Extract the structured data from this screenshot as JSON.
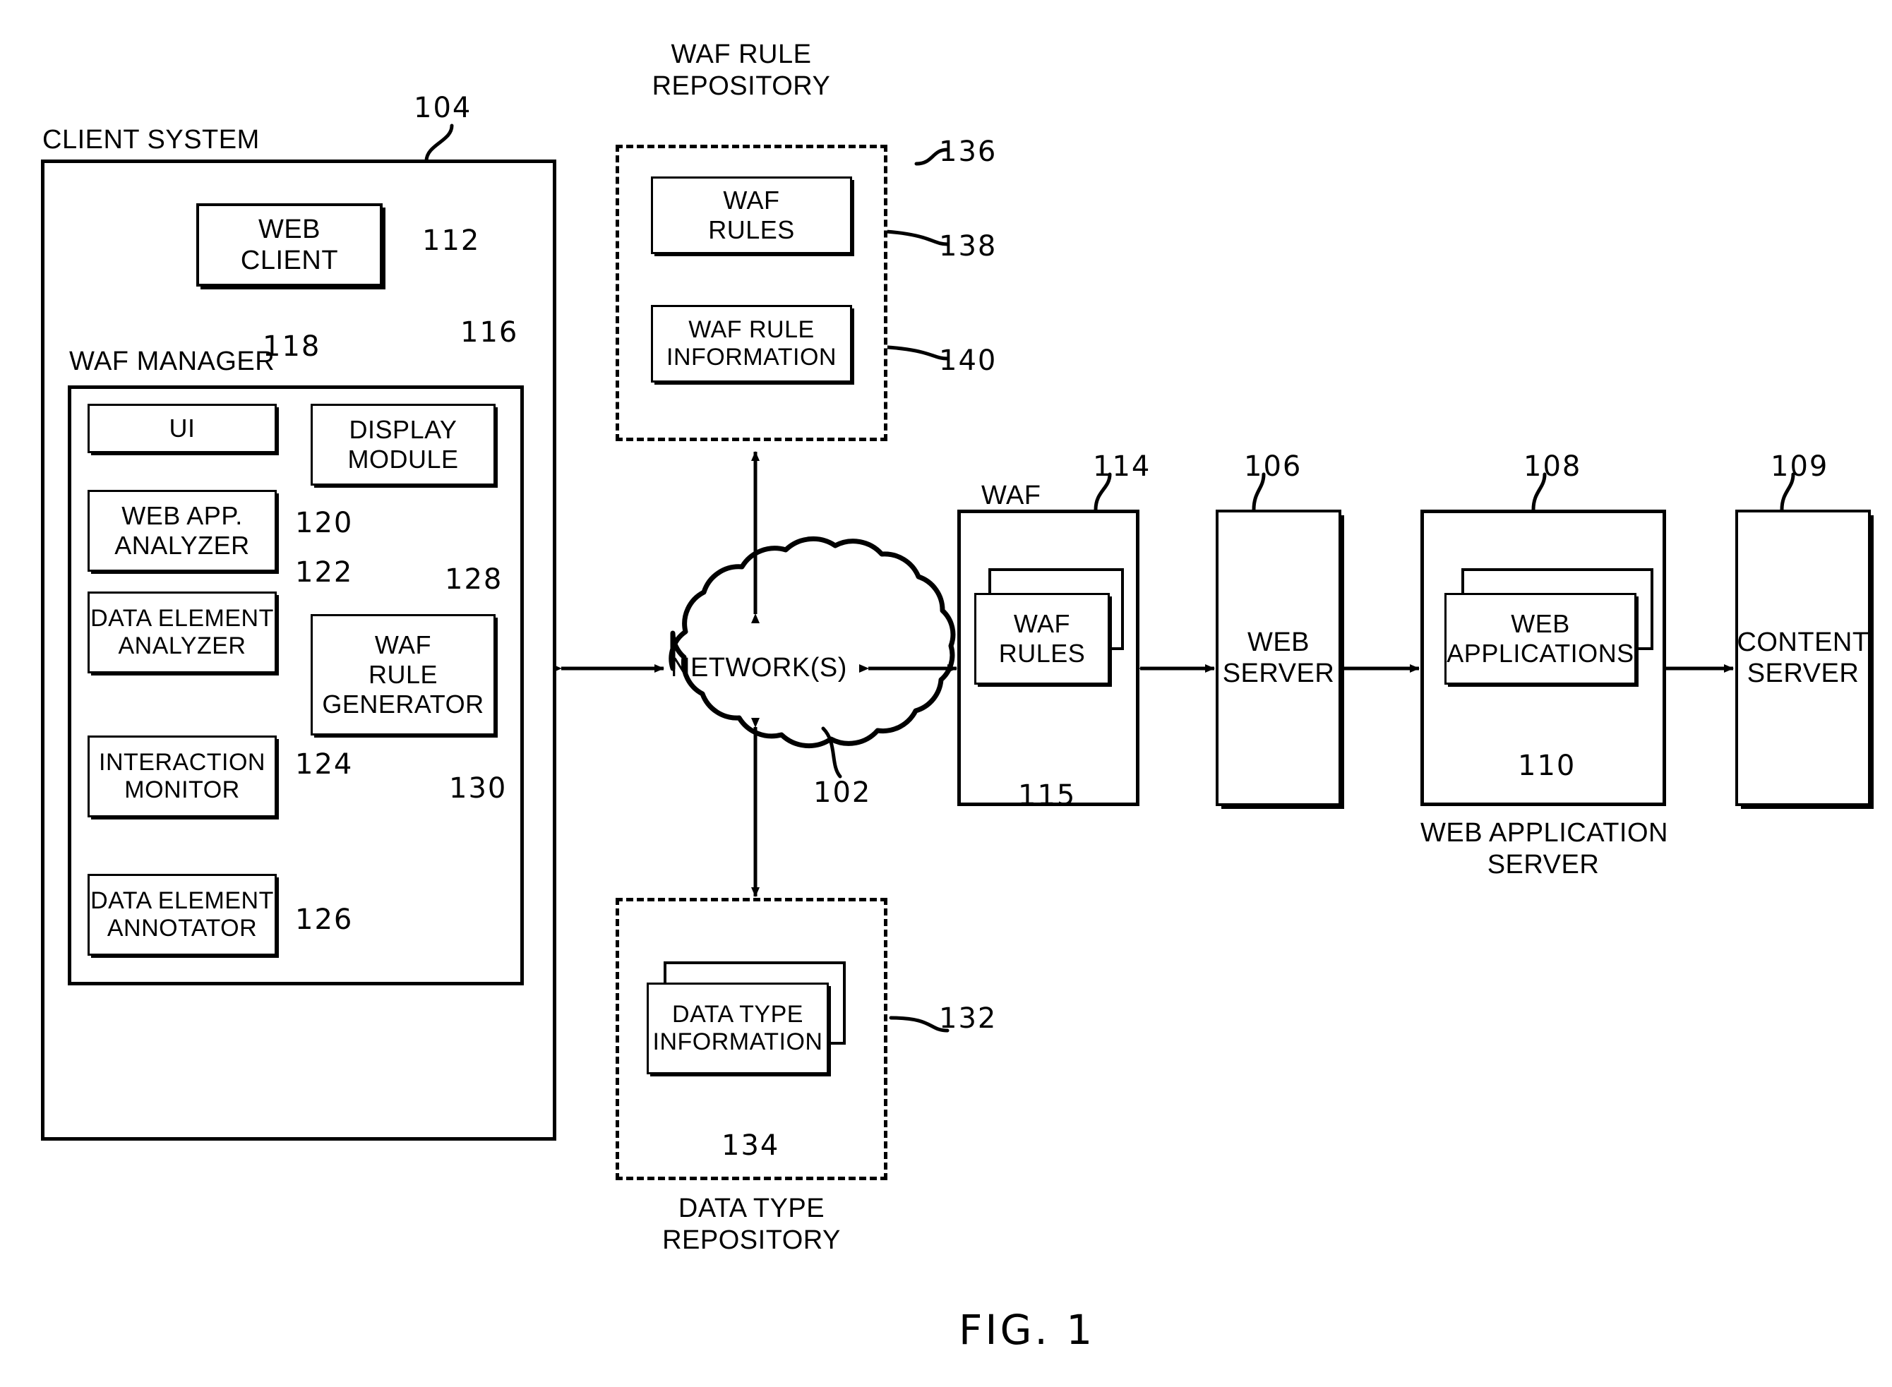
{
  "figure": {
    "caption": "FIG. 1"
  },
  "client_system": {
    "title": "CLIENT SYSTEM",
    "ref": "104",
    "web_client": {
      "label": "WEB\nCLIENT",
      "ref": "112"
    },
    "waf_manager": {
      "title": "WAF MANAGER",
      "ref": "116",
      "modules": [
        {
          "label": "UI",
          "ref": "118"
        },
        {
          "label": "WEB APP.\nANALYZER",
          "ref": "120"
        },
        {
          "label": "DATA ELEMENT\nANALYZER",
          "ref": "122"
        },
        {
          "label": "INTERACTION\nMONITOR",
          "ref": "124"
        },
        {
          "label": "DATA ELEMENT\nANNOTATOR",
          "ref": "126"
        },
        {
          "label": "DISPLAY\nMODULE",
          "ref": "128"
        },
        {
          "label": "WAF\nRULE\nGENERATOR",
          "ref": "130"
        }
      ]
    }
  },
  "waf_rule_repository": {
    "title": "WAF RULE\nREPOSITORY",
    "ref": "136",
    "items": [
      {
        "label": "WAF\nRULES",
        "ref": "138"
      },
      {
        "label": "WAF RULE\nINFORMATION",
        "ref": "140"
      }
    ]
  },
  "data_type_repository": {
    "title": "DATA TYPE\nREPOSITORY",
    "ref": "132",
    "items": [
      {
        "label": "DATA TYPE\nINFORMATION",
        "ref": "134"
      }
    ]
  },
  "network": {
    "label": "NETWORK(S)",
    "ref": "102"
  },
  "waf": {
    "title": "WAF",
    "ref": "114",
    "inner": {
      "label": "WAF\nRULES",
      "ref": "115"
    }
  },
  "web_server": {
    "label": "WEB\nSERVER",
    "ref": "106"
  },
  "web_application_server": {
    "caption": "WEB APPLICATION\nSERVER",
    "ref": "108",
    "inner": {
      "label": "WEB\nAPPLICATIONS",
      "ref": "110"
    }
  },
  "content_server": {
    "label": "CONTENT\nSERVER",
    "ref": "109"
  },
  "colors": {
    "ink": "#000000",
    "paper": "#ffffff"
  }
}
